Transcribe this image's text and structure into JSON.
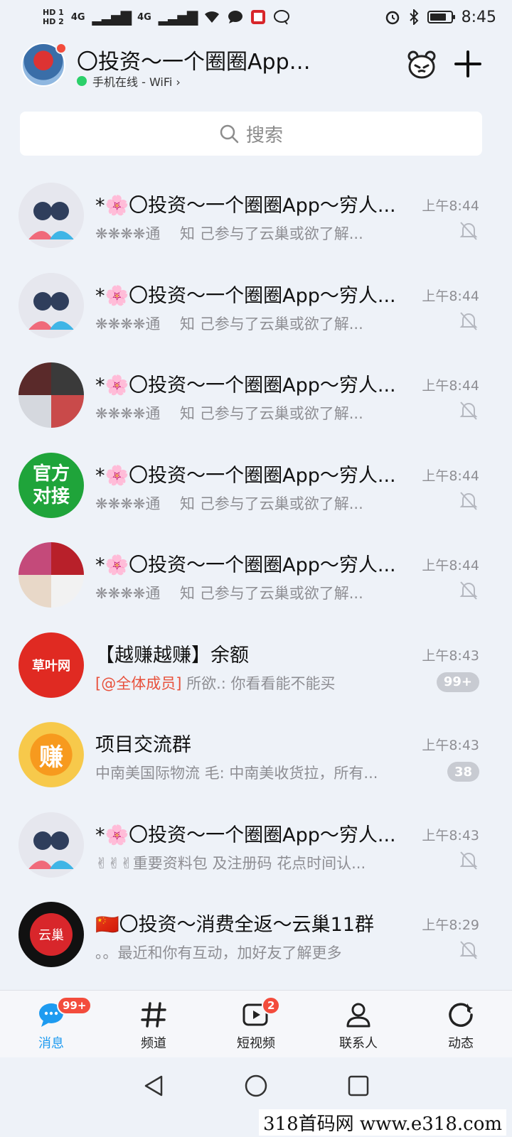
{
  "status_bar": {
    "hd1": "HD 1",
    "hd2": "HD 2",
    "net1": "4G",
    "net2": "4G",
    "time": "8:45"
  },
  "header": {
    "title": "〇投资～一个圈圈App～...",
    "online_status": "手机在线 - WiFi ›"
  },
  "search": {
    "placeholder": "搜索"
  },
  "conversations": [
    {
      "title": "*🌸〇投资～一个圈圈App～穷人...",
      "time": "上午8:44",
      "preview": "❋❋❋❋通　 知 己参与了云巢或欲了解...",
      "muted": true
    },
    {
      "title": "*🌸〇投资～一个圈圈App～穷人...",
      "time": "上午8:44",
      "preview": "❋❋❋❋通　 知 己参与了云巢或欲了解...",
      "muted": true
    },
    {
      "title": "*🌸〇投资～一个圈圈App～穷人...",
      "time": "上午8:44",
      "preview": "❋❋❋❋通　 知 己参与了云巢或欲了解...",
      "muted": true
    },
    {
      "title": "*🌸〇投资～一个圈圈App～穷人...",
      "time": "上午8:44",
      "preview": "❋❋❋❋通　 知 己参与了云巢或欲了解...",
      "muted": true,
      "avatar_text": [
        "官方",
        "对接"
      ]
    },
    {
      "title": "*🌸〇投资～一个圈圈App～穷人...",
      "time": "上午8:44",
      "preview": "❋❋❋❋通　 知 己参与了云巢或欲了解...",
      "muted": true
    },
    {
      "title": "【越赚越赚】余额",
      "time": "上午8:43",
      "mention": "[@全体成员]",
      "preview": " 所欲.: 你看看能不能买",
      "badge": "99+",
      "avatar_text": "草叶网"
    },
    {
      "title": "项目交流群",
      "time": "上午8:43",
      "preview": "中南美国际物流 毛: 中南美收货拉，所有...",
      "badge": "38",
      "avatar_text": "赚"
    },
    {
      "title": "*🌸〇投资～一个圈圈App～穷人...",
      "time": "上午8:43",
      "preview": "✌✌✌重要资料包 及注册码 花点时间认...",
      "muted": true
    },
    {
      "title": "🇨🇳〇投资～消费全返～云巢11群",
      "time": "上午8:29",
      "preview": "。。最近和你有互动，加好友了解更多",
      "muted": true,
      "avatar_text": "云巢"
    }
  ],
  "bottom_nav": {
    "tabs": [
      {
        "label": "消息",
        "badge": "99+",
        "active": true
      },
      {
        "label": "频道"
      },
      {
        "label": "短视频",
        "badge": "2"
      },
      {
        "label": "联系人"
      },
      {
        "label": "动态"
      }
    ]
  },
  "watermark": "318首码网 www.e318.com",
  "colors": {
    "accent": "#1e9bf0",
    "badge_red": "#f34c3c",
    "mention": "#e8513c",
    "background": "#eef2f8"
  }
}
